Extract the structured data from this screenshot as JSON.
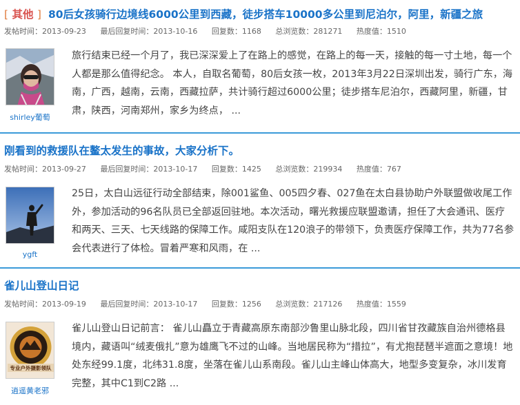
{
  "posts": [
    {
      "tag_open": "[",
      "tag": "其他",
      "tag_close": "]",
      "title": "80后女孩骑行边境线6000公里到西藏，徒步搭车10000多公里到尼泊尔，阿里，新疆之旅",
      "post_time_label": "发帖时间：2013-09-23",
      "reply_time_label": "最后回复时间：2013-10-16",
      "replies_label": "回复数：1168",
      "views_label": "总浏览数：281271",
      "hot_label": "热度值：1510",
      "author": "shirley葡萄",
      "excerpt": "旅行结束已经一个月了，我已深深爱上了在路上的感觉，在路上的每一天，接触的每一寸土地，每一个人都是那么值得纪念。 本人，自取名葡萄，80后女孩一枚，2013年3月22日深圳出发，骑行广东，海南，广西，越南，云南，西藏拉萨，共计骑行超过6000公里；徒步搭车尼泊尔，西藏阿里，新疆，甘肃，陕西，河南郑州，家乡为终点， ..."
    },
    {
      "title": "刚看到的救援队在鳌太发生的事故，大家分析下。",
      "post_time_label": "发帖时间：2013-09-27",
      "reply_time_label": "最后回复时间：2013-10-17",
      "replies_label": "回复数：1425",
      "views_label": "总浏览数：219934",
      "hot_label": "热度值：767",
      "author": "ygft",
      "excerpt": "25日，太白山远征行动全部结束，除001鲨鱼、005四夕春、027鱼在太白县协助户外联盟做收尾工作外，参加活动的96名队员已全部返回驻地。本次活动，曙光救援应联盟邀请，担任了大会通讯、医疗和两天、三天、七天线路的保障工作。咸阳支队在120浪子的带领下，负责医疗保障工作，共为77名参会代表进行了体检。冒着严寒和风雨，在 ..."
    },
    {
      "title": "雀儿山登山日记",
      "post_time_label": "发帖时间：2013-09-19",
      "reply_time_label": "最后回复时间：2013-10-17",
      "replies_label": "回复数：1256",
      "views_label": "总浏览数：217126",
      "hot_label": "热度值：1559",
      "author": "逍遥黄老邪",
      "avatar_text": "专业户外摄影领队",
      "excerpt": "雀儿山登山日记前言： 雀儿山矗立于青藏高原东南部沙鲁里山脉北段，四川省甘孜藏族自治州德格县境内，藏语叫“绒麦俄扎”意为雄鹰飞不过的山峰。当地居民称为“措拉”，有尤抱琵琶半遮面之意境！地处东经99.1度，北纬31.8度，坐落在雀儿山系南段。雀儿山主峰山体高大，地型多变复杂，冰川发育完整，其中C1到C2路 ..."
    }
  ]
}
